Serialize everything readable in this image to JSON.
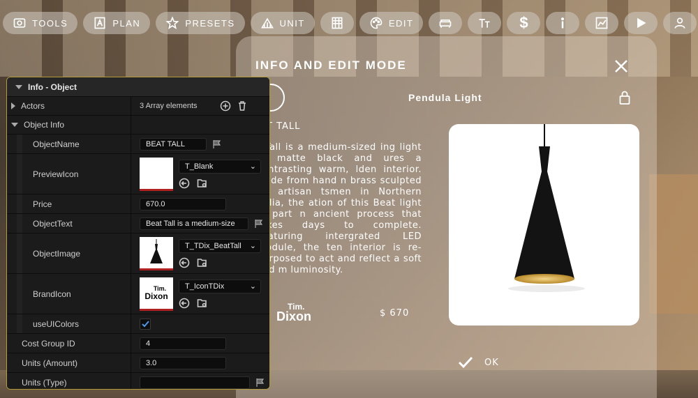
{
  "toolbar": {
    "items": [
      {
        "label": "TOOLS",
        "icon": "camera-icon"
      },
      {
        "label": "PLAN",
        "icon": "plan-icon"
      },
      {
        "label": "PRESETS",
        "icon": "star-icon"
      },
      {
        "label": "UNIT",
        "icon": "unit-icon"
      },
      {
        "label": "",
        "icon": "building-icon"
      },
      {
        "label": "EDIT",
        "icon": "palette-icon"
      },
      {
        "label": "",
        "icon": "sofa-icon"
      },
      {
        "label": "",
        "icon": "height-icon"
      },
      {
        "label": "$",
        "icon": "dollar-icon"
      },
      {
        "label": "",
        "icon": "info-icon"
      },
      {
        "label": "",
        "icon": "chart-icon"
      },
      {
        "label": "",
        "icon": "play-icon"
      },
      {
        "label": "",
        "icon": "user-icon"
      },
      {
        "label": "",
        "icon": "gear-icon"
      }
    ]
  },
  "modal": {
    "title": "INFO AND EDIT MODE",
    "object_title": "Pendula Light",
    "subtitle": "T TALL",
    "description": "t Tall is a medium-sized ing light in matte black and ures a contrasting warm, lden interior. Made from hand n brass sculpted by artisan tsmen in Northern India, the ation of this Beat light is part n ancient process that takes days to complete. Featuring intergrated LED module, the ten interior is re-purposed to act and reflect a soft and m luminosity.",
    "brand_line1": "Tim.",
    "brand_line2": "Dixon",
    "price": "$ 670",
    "ok_label": "OK"
  },
  "inspector": {
    "title": "Info - Object",
    "actors_label": "Actors",
    "actors_value": "3 Array elements",
    "object_info_label": "Object Info",
    "rows": {
      "object_name": {
        "label": "ObjectName",
        "value": "BEAT TALL"
      },
      "preview_icon": {
        "label": "PreviewIcon",
        "value": "T_Blank"
      },
      "price": {
        "label": "Price",
        "value": "670.0"
      },
      "object_text": {
        "label": "ObjectText",
        "value": "Beat Tall is a medium-size"
      },
      "object_image": {
        "label": "ObjectImage",
        "value": "T_TDix_BeatTall"
      },
      "brand_icon": {
        "label": "BrandIcon",
        "value": "T_IconTDix",
        "thumb_line1": "Tim.",
        "thumb_line2": "Dixon"
      },
      "use_ui_colors": {
        "label": "useUIColors",
        "checked": true
      },
      "cost_group_id": {
        "label": "Cost Group ID",
        "value": "4"
      },
      "units_amount": {
        "label": "Units (Amount)",
        "value": "3.0"
      },
      "units_type": {
        "label": "Units (Type)",
        "value": ""
      }
    }
  }
}
